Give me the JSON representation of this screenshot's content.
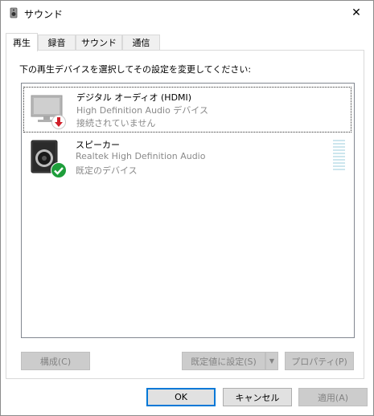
{
  "window": {
    "title": "サウンド",
    "close_glyph": "✕"
  },
  "tabs": [
    {
      "label": "再生",
      "active": true
    },
    {
      "label": "録音",
      "active": false
    },
    {
      "label": "サウンド",
      "active": false
    },
    {
      "label": "通信",
      "active": false
    }
  ],
  "panel": {
    "instruction": "下の再生デバイスを選択してその設定を変更してください:"
  },
  "devices": [
    {
      "name": "デジタル オーディオ (HDMI)",
      "line2": "High Definition Audio デバイス",
      "line3": "接続されていません",
      "icon": "monitor-icon",
      "status_icon": "disconnected-arrow-icon",
      "selected": true
    },
    {
      "name": "スピーカー",
      "line2": "Realtek High Definition Audio",
      "line3": "既定のデバイス",
      "icon": "speaker-icon",
      "status_icon": "default-check-icon",
      "selected": false
    }
  ],
  "buttons": {
    "configure": "構成(C)",
    "set_default": "既定値に設定(S)",
    "properties": "プロパティ(P)",
    "ok": "OK",
    "cancel": "キャンセル",
    "apply": "適用(A)"
  },
  "colors": {
    "accent": "#0078d7",
    "check_green": "#1e9e3b",
    "disconnected_red": "#d0202a",
    "meter": "#cde6ee"
  }
}
